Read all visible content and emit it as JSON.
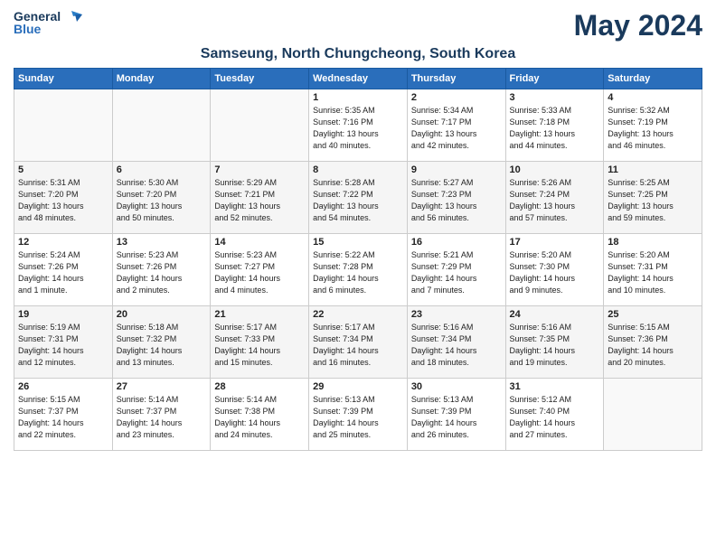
{
  "logo": {
    "line1": "General",
    "line2": "Blue"
  },
  "title": "May 2024",
  "subtitle": "Samseung, North Chungcheong, South Korea",
  "headers": [
    "Sunday",
    "Monday",
    "Tuesday",
    "Wednesday",
    "Thursday",
    "Friday",
    "Saturday"
  ],
  "weeks": [
    [
      {
        "day": "",
        "info": ""
      },
      {
        "day": "",
        "info": ""
      },
      {
        "day": "",
        "info": ""
      },
      {
        "day": "1",
        "info": "Sunrise: 5:35 AM\nSunset: 7:16 PM\nDaylight: 13 hours\nand 40 minutes."
      },
      {
        "day": "2",
        "info": "Sunrise: 5:34 AM\nSunset: 7:17 PM\nDaylight: 13 hours\nand 42 minutes."
      },
      {
        "day": "3",
        "info": "Sunrise: 5:33 AM\nSunset: 7:18 PM\nDaylight: 13 hours\nand 44 minutes."
      },
      {
        "day": "4",
        "info": "Sunrise: 5:32 AM\nSunset: 7:19 PM\nDaylight: 13 hours\nand 46 minutes."
      }
    ],
    [
      {
        "day": "5",
        "info": "Sunrise: 5:31 AM\nSunset: 7:20 PM\nDaylight: 13 hours\nand 48 minutes."
      },
      {
        "day": "6",
        "info": "Sunrise: 5:30 AM\nSunset: 7:20 PM\nDaylight: 13 hours\nand 50 minutes."
      },
      {
        "day": "7",
        "info": "Sunrise: 5:29 AM\nSunset: 7:21 PM\nDaylight: 13 hours\nand 52 minutes."
      },
      {
        "day": "8",
        "info": "Sunrise: 5:28 AM\nSunset: 7:22 PM\nDaylight: 13 hours\nand 54 minutes."
      },
      {
        "day": "9",
        "info": "Sunrise: 5:27 AM\nSunset: 7:23 PM\nDaylight: 13 hours\nand 56 minutes."
      },
      {
        "day": "10",
        "info": "Sunrise: 5:26 AM\nSunset: 7:24 PM\nDaylight: 13 hours\nand 57 minutes."
      },
      {
        "day": "11",
        "info": "Sunrise: 5:25 AM\nSunset: 7:25 PM\nDaylight: 13 hours\nand 59 minutes."
      }
    ],
    [
      {
        "day": "12",
        "info": "Sunrise: 5:24 AM\nSunset: 7:26 PM\nDaylight: 14 hours\nand 1 minute."
      },
      {
        "day": "13",
        "info": "Sunrise: 5:23 AM\nSunset: 7:26 PM\nDaylight: 14 hours\nand 2 minutes."
      },
      {
        "day": "14",
        "info": "Sunrise: 5:23 AM\nSunset: 7:27 PM\nDaylight: 14 hours\nand 4 minutes."
      },
      {
        "day": "15",
        "info": "Sunrise: 5:22 AM\nSunset: 7:28 PM\nDaylight: 14 hours\nand 6 minutes."
      },
      {
        "day": "16",
        "info": "Sunrise: 5:21 AM\nSunset: 7:29 PM\nDaylight: 14 hours\nand 7 minutes."
      },
      {
        "day": "17",
        "info": "Sunrise: 5:20 AM\nSunset: 7:30 PM\nDaylight: 14 hours\nand 9 minutes."
      },
      {
        "day": "18",
        "info": "Sunrise: 5:20 AM\nSunset: 7:31 PM\nDaylight: 14 hours\nand 10 minutes."
      }
    ],
    [
      {
        "day": "19",
        "info": "Sunrise: 5:19 AM\nSunset: 7:31 PM\nDaylight: 14 hours\nand 12 minutes."
      },
      {
        "day": "20",
        "info": "Sunrise: 5:18 AM\nSunset: 7:32 PM\nDaylight: 14 hours\nand 13 minutes."
      },
      {
        "day": "21",
        "info": "Sunrise: 5:17 AM\nSunset: 7:33 PM\nDaylight: 14 hours\nand 15 minutes."
      },
      {
        "day": "22",
        "info": "Sunrise: 5:17 AM\nSunset: 7:34 PM\nDaylight: 14 hours\nand 16 minutes."
      },
      {
        "day": "23",
        "info": "Sunrise: 5:16 AM\nSunset: 7:34 PM\nDaylight: 14 hours\nand 18 minutes."
      },
      {
        "day": "24",
        "info": "Sunrise: 5:16 AM\nSunset: 7:35 PM\nDaylight: 14 hours\nand 19 minutes."
      },
      {
        "day": "25",
        "info": "Sunrise: 5:15 AM\nSunset: 7:36 PM\nDaylight: 14 hours\nand 20 minutes."
      }
    ],
    [
      {
        "day": "26",
        "info": "Sunrise: 5:15 AM\nSunset: 7:37 PM\nDaylight: 14 hours\nand 22 minutes."
      },
      {
        "day": "27",
        "info": "Sunrise: 5:14 AM\nSunset: 7:37 PM\nDaylight: 14 hours\nand 23 minutes."
      },
      {
        "day": "28",
        "info": "Sunrise: 5:14 AM\nSunset: 7:38 PM\nDaylight: 14 hours\nand 24 minutes."
      },
      {
        "day": "29",
        "info": "Sunrise: 5:13 AM\nSunset: 7:39 PM\nDaylight: 14 hours\nand 25 minutes."
      },
      {
        "day": "30",
        "info": "Sunrise: 5:13 AM\nSunset: 7:39 PM\nDaylight: 14 hours\nand 26 minutes."
      },
      {
        "day": "31",
        "info": "Sunrise: 5:12 AM\nSunset: 7:40 PM\nDaylight: 14 hours\nand 27 minutes."
      },
      {
        "day": "",
        "info": ""
      }
    ]
  ]
}
